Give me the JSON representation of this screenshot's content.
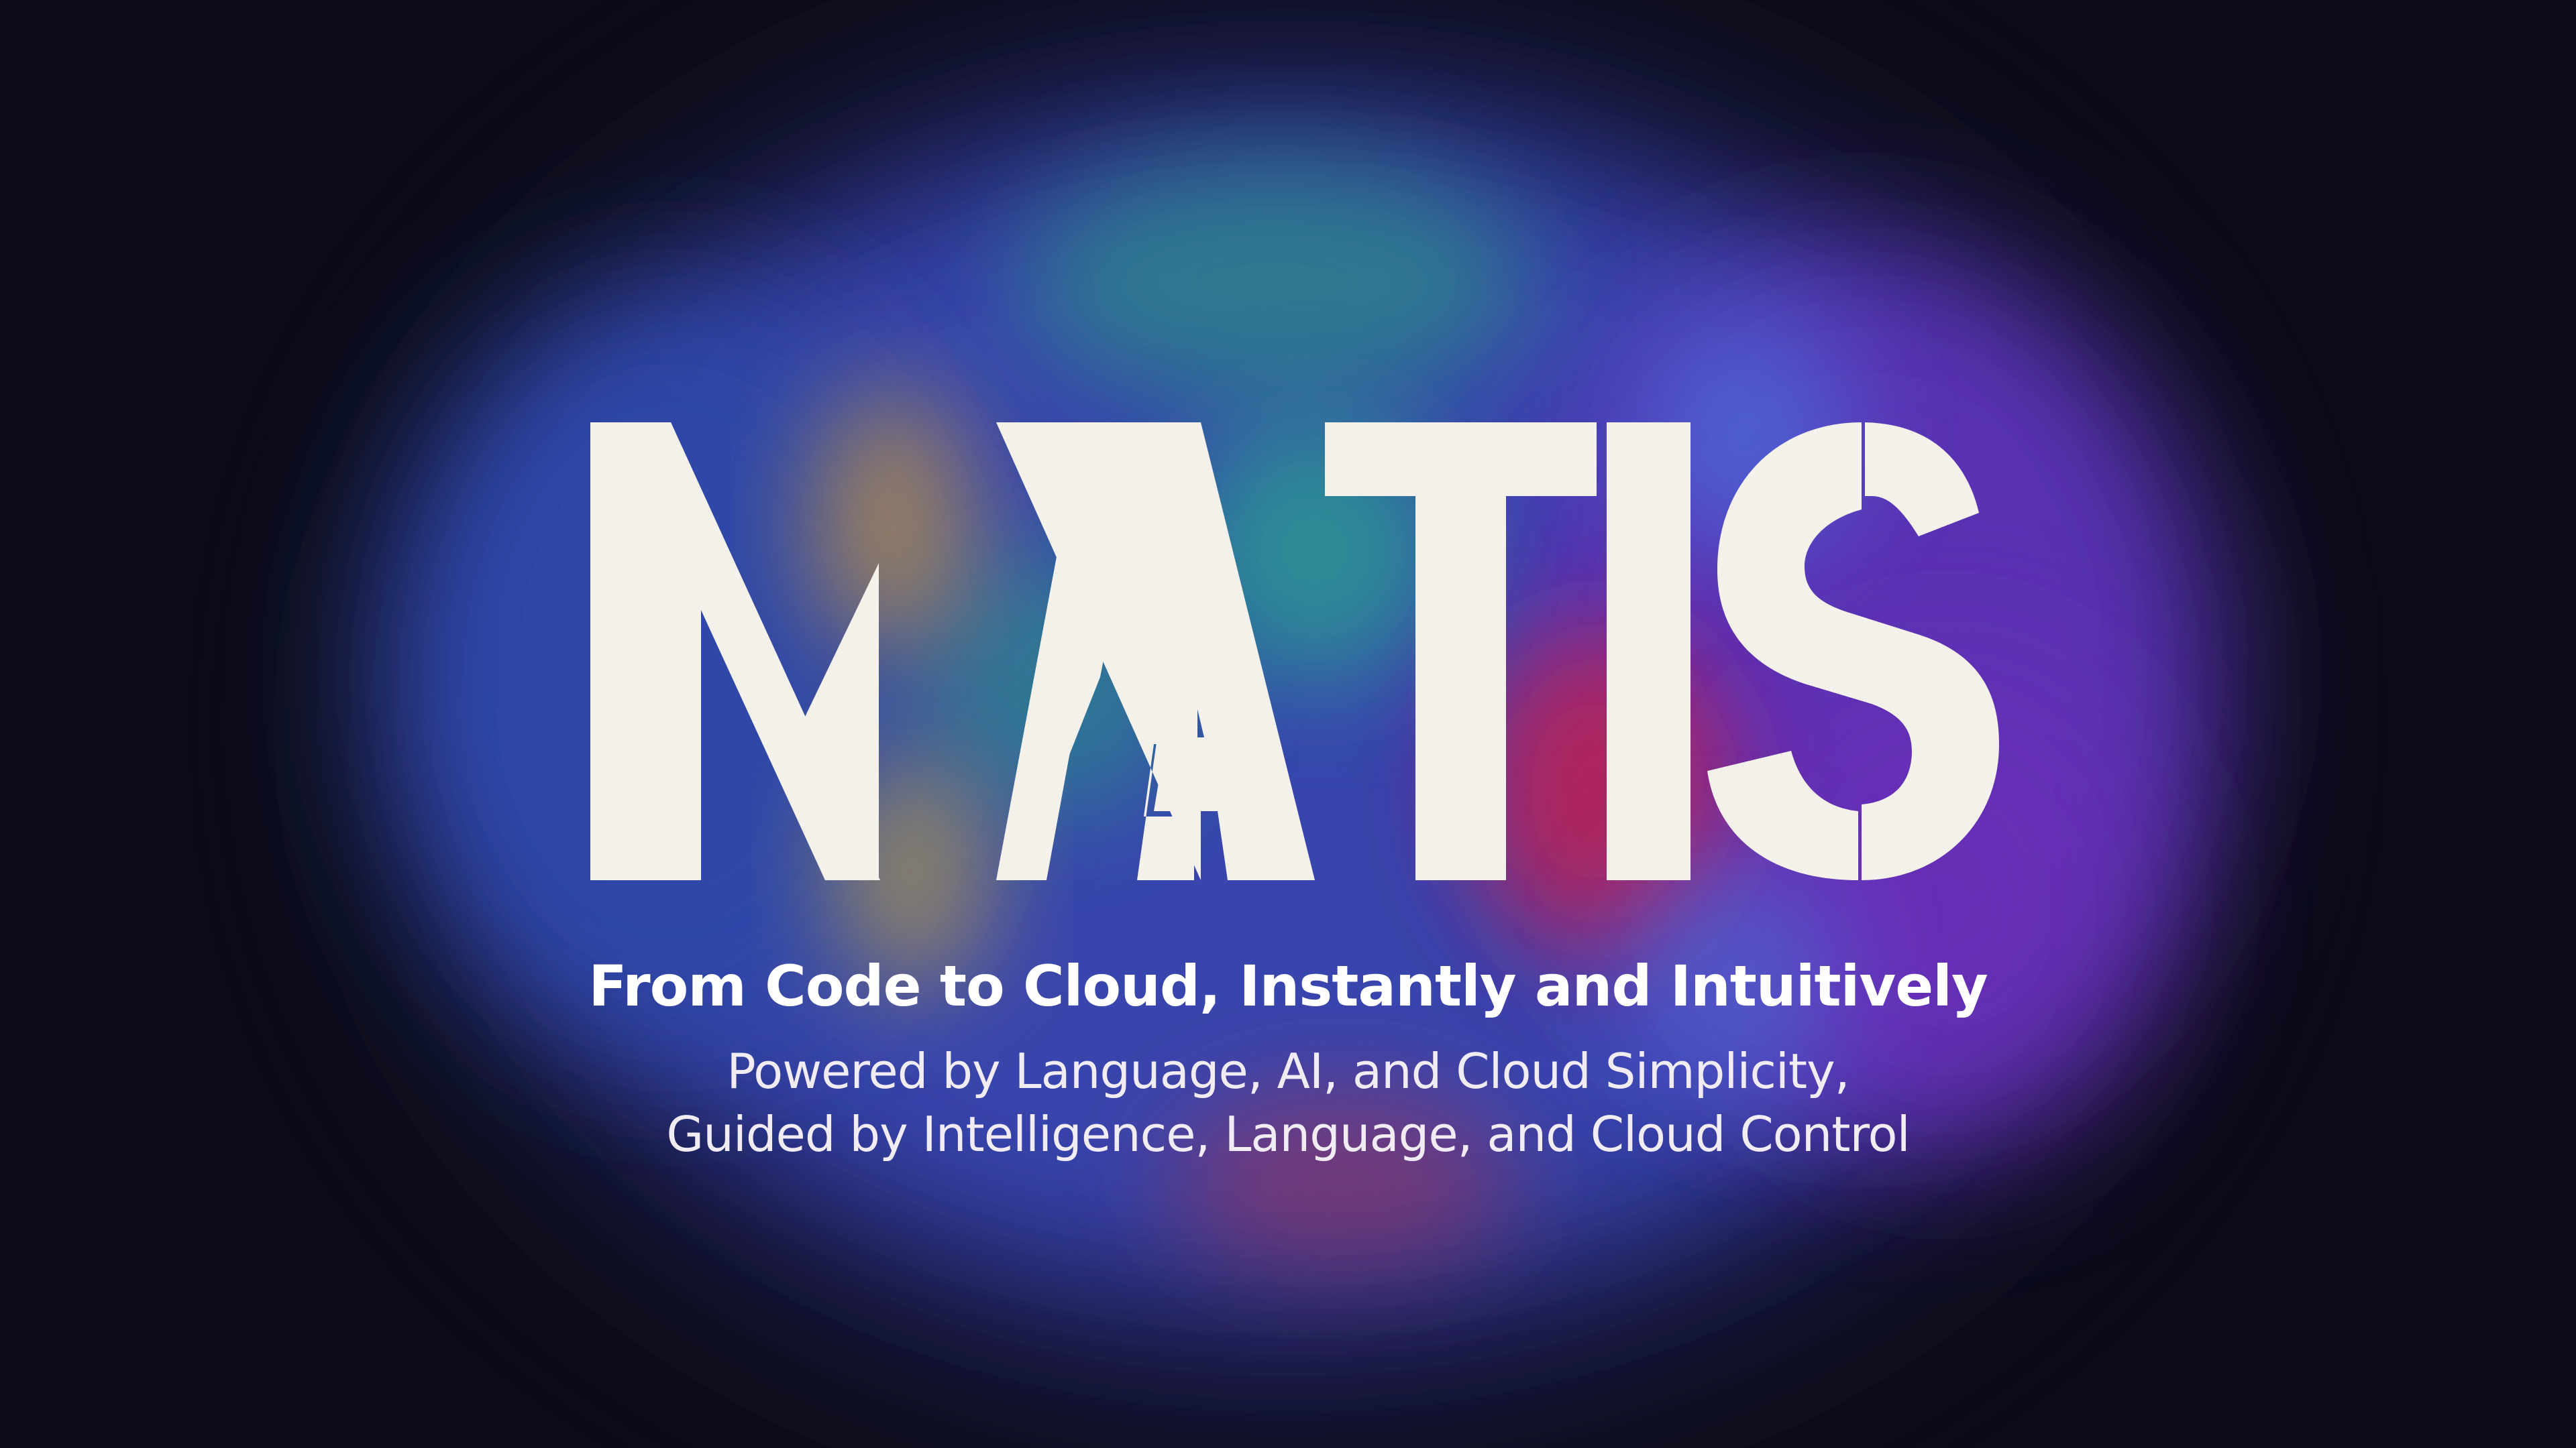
{
  "brand": {
    "name": "MATIS",
    "letter_color": "#f4f0ea",
    "background_color": "#0c0c18"
  },
  "tagline": "From Code to Cloud, Instantly and Intuitively",
  "subtitle_line1": "Powered by Language, AI, and Cloud Simplicity,",
  "subtitle_line2": "Guided by Intelligence, Language, and Cloud Control",
  "glow_colors": {
    "blue": "#3b46b0",
    "violet": "#5b34b4",
    "teal": "#2a8f8a",
    "amber": "#c79a3a",
    "crimson": "#c8224f"
  }
}
